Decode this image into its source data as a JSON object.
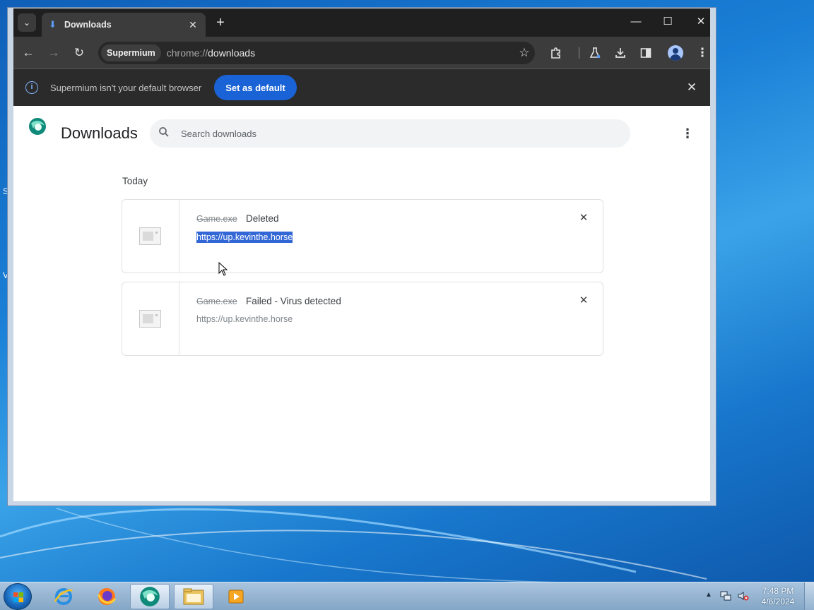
{
  "browser": {
    "tab": {
      "title": "Downloads"
    },
    "omnibox": {
      "chip": "Supermium",
      "url_scheme": "chrome://",
      "url_path": "downloads"
    },
    "infobar": {
      "message": "Supermium isn't your default browser",
      "button_label": "Set as default"
    }
  },
  "downloads_page": {
    "title": "Downloads",
    "search_placeholder": "Search downloads",
    "date_header": "Today",
    "items": [
      {
        "file_name": "Game.exe",
        "status": "Deleted",
        "url": "https://up.kevinthe.horse",
        "url_selected": true
      },
      {
        "file_name": "Game.exe",
        "status": "Failed - Virus detected",
        "url": "https://up.kevinthe.horse",
        "url_selected": false
      }
    ]
  },
  "taskbar": {
    "clock": {
      "time": "7:48 PM",
      "date": "4/6/2024"
    }
  },
  "desktop": {
    "icon_fragments": [
      "S",
      "V"
    ]
  },
  "colors": {
    "accent": "#1a63d6",
    "selection": "#3367d6",
    "tab_icon": "#5b9cf5",
    "info_icon": "#7fb0f5"
  }
}
